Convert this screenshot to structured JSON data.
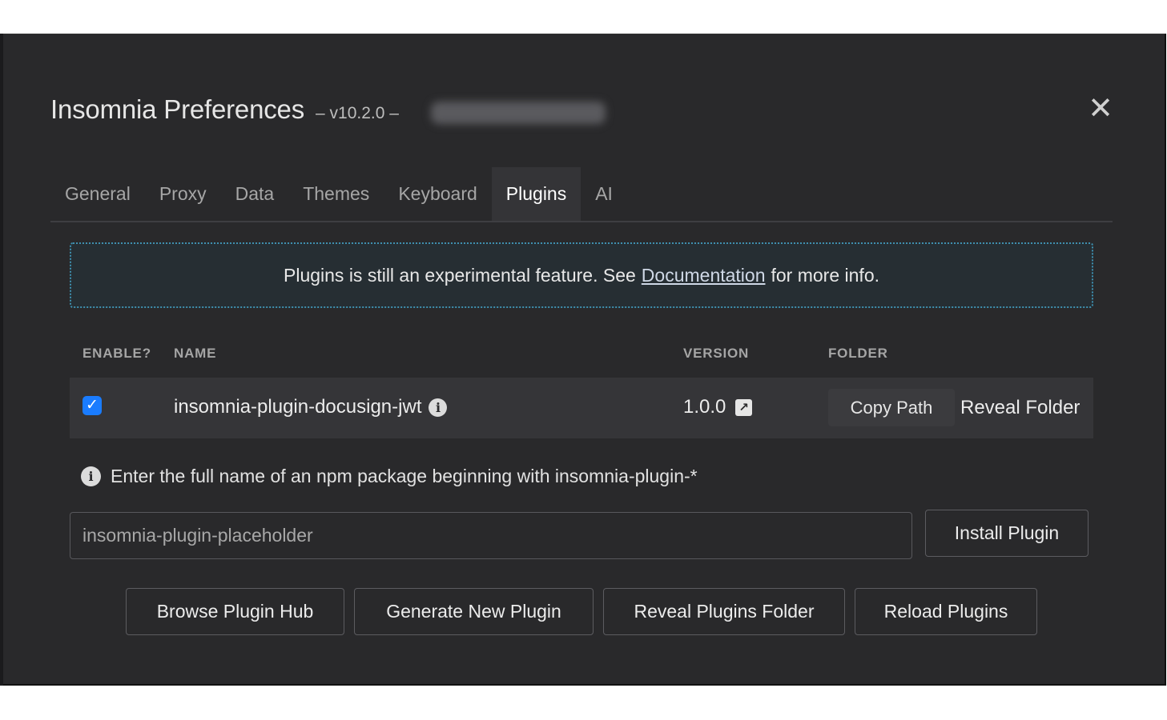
{
  "header": {
    "title": "Insomnia Preferences",
    "version": "– v10.2.0 –",
    "close_icon": "✕"
  },
  "tabs": [
    {
      "label": "General",
      "active": false
    },
    {
      "label": "Proxy",
      "active": false
    },
    {
      "label": "Data",
      "active": false
    },
    {
      "label": "Themes",
      "active": false
    },
    {
      "label": "Keyboard",
      "active": false
    },
    {
      "label": "Plugins",
      "active": true
    },
    {
      "label": "AI",
      "active": false
    }
  ],
  "notice": {
    "before": "Plugins is still an experimental feature. See",
    "link": "Documentation",
    "after": "for more info."
  },
  "table": {
    "headers": {
      "enable": "ENABLE?",
      "name": "NAME",
      "version": "VERSION",
      "folder": "FOLDER"
    },
    "rows": [
      {
        "enabled": true,
        "name": "insomnia-plugin-docusign-jwt",
        "version": "1.0.0",
        "copy_path": "Copy Path",
        "reveal_folder": "Reveal Folder"
      }
    ]
  },
  "icons": {
    "info": "i",
    "external_link": "↗",
    "check": "✓"
  },
  "install": {
    "hint": "Enter the full name of an npm package beginning with insomnia-plugin-*",
    "placeholder": "insomnia-plugin-placeholder",
    "button": "Install Plugin"
  },
  "actions": {
    "browse": "Browse Plugin Hub",
    "generate": "Generate New Plugin",
    "reveal": "Reveal Plugins Folder",
    "reload": "Reload Plugins"
  },
  "colors": {
    "modal_bg": "#29292b",
    "accent_blue": "#1a7cff",
    "notice_border": "#3f8fae"
  }
}
